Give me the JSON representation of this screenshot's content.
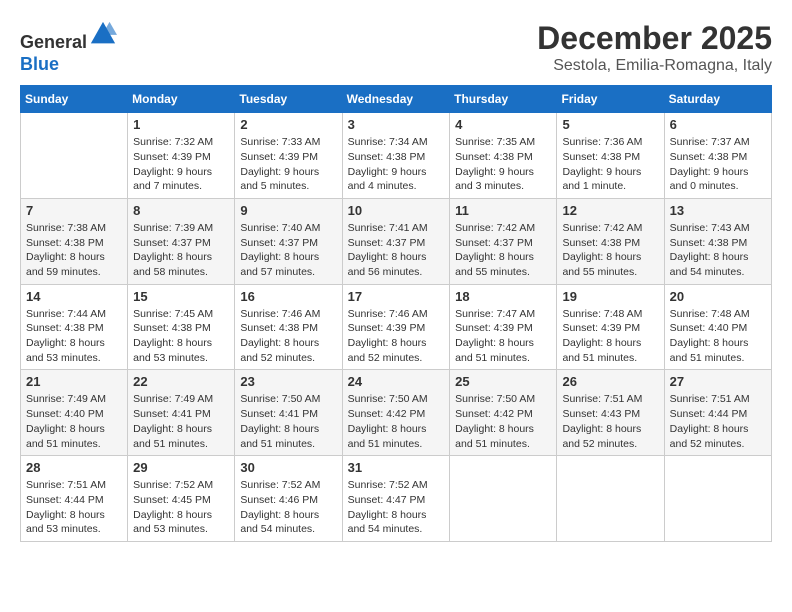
{
  "header": {
    "logo_general": "General",
    "logo_blue": "Blue",
    "month_title": "December 2025",
    "location": "Sestola, Emilia-Romagna, Italy"
  },
  "days_of_week": [
    "Sunday",
    "Monday",
    "Tuesday",
    "Wednesday",
    "Thursday",
    "Friday",
    "Saturday"
  ],
  "weeks": [
    [
      {
        "day": "",
        "sunrise": "",
        "sunset": "",
        "daylight": ""
      },
      {
        "day": "1",
        "sunrise": "Sunrise: 7:32 AM",
        "sunset": "Sunset: 4:39 PM",
        "daylight": "Daylight: 9 hours and 7 minutes."
      },
      {
        "day": "2",
        "sunrise": "Sunrise: 7:33 AM",
        "sunset": "Sunset: 4:39 PM",
        "daylight": "Daylight: 9 hours and 5 minutes."
      },
      {
        "day": "3",
        "sunrise": "Sunrise: 7:34 AM",
        "sunset": "Sunset: 4:38 PM",
        "daylight": "Daylight: 9 hours and 4 minutes."
      },
      {
        "day": "4",
        "sunrise": "Sunrise: 7:35 AM",
        "sunset": "Sunset: 4:38 PM",
        "daylight": "Daylight: 9 hours and 3 minutes."
      },
      {
        "day": "5",
        "sunrise": "Sunrise: 7:36 AM",
        "sunset": "Sunset: 4:38 PM",
        "daylight": "Daylight: 9 hours and 1 minute."
      },
      {
        "day": "6",
        "sunrise": "Sunrise: 7:37 AM",
        "sunset": "Sunset: 4:38 PM",
        "daylight": "Daylight: 9 hours and 0 minutes."
      }
    ],
    [
      {
        "day": "7",
        "sunrise": "Sunrise: 7:38 AM",
        "sunset": "Sunset: 4:38 PM",
        "daylight": "Daylight: 8 hours and 59 minutes."
      },
      {
        "day": "8",
        "sunrise": "Sunrise: 7:39 AM",
        "sunset": "Sunset: 4:37 PM",
        "daylight": "Daylight: 8 hours and 58 minutes."
      },
      {
        "day": "9",
        "sunrise": "Sunrise: 7:40 AM",
        "sunset": "Sunset: 4:37 PM",
        "daylight": "Daylight: 8 hours and 57 minutes."
      },
      {
        "day": "10",
        "sunrise": "Sunrise: 7:41 AM",
        "sunset": "Sunset: 4:37 PM",
        "daylight": "Daylight: 8 hours and 56 minutes."
      },
      {
        "day": "11",
        "sunrise": "Sunrise: 7:42 AM",
        "sunset": "Sunset: 4:37 PM",
        "daylight": "Daylight: 8 hours and 55 minutes."
      },
      {
        "day": "12",
        "sunrise": "Sunrise: 7:42 AM",
        "sunset": "Sunset: 4:38 PM",
        "daylight": "Daylight: 8 hours and 55 minutes."
      },
      {
        "day": "13",
        "sunrise": "Sunrise: 7:43 AM",
        "sunset": "Sunset: 4:38 PM",
        "daylight": "Daylight: 8 hours and 54 minutes."
      }
    ],
    [
      {
        "day": "14",
        "sunrise": "Sunrise: 7:44 AM",
        "sunset": "Sunset: 4:38 PM",
        "daylight": "Daylight: 8 hours and 53 minutes."
      },
      {
        "day": "15",
        "sunrise": "Sunrise: 7:45 AM",
        "sunset": "Sunset: 4:38 PM",
        "daylight": "Daylight: 8 hours and 53 minutes."
      },
      {
        "day": "16",
        "sunrise": "Sunrise: 7:46 AM",
        "sunset": "Sunset: 4:38 PM",
        "daylight": "Daylight: 8 hours and 52 minutes."
      },
      {
        "day": "17",
        "sunrise": "Sunrise: 7:46 AM",
        "sunset": "Sunset: 4:39 PM",
        "daylight": "Daylight: 8 hours and 52 minutes."
      },
      {
        "day": "18",
        "sunrise": "Sunrise: 7:47 AM",
        "sunset": "Sunset: 4:39 PM",
        "daylight": "Daylight: 8 hours and 51 minutes."
      },
      {
        "day": "19",
        "sunrise": "Sunrise: 7:48 AM",
        "sunset": "Sunset: 4:39 PM",
        "daylight": "Daylight: 8 hours and 51 minutes."
      },
      {
        "day": "20",
        "sunrise": "Sunrise: 7:48 AM",
        "sunset": "Sunset: 4:40 PM",
        "daylight": "Daylight: 8 hours and 51 minutes."
      }
    ],
    [
      {
        "day": "21",
        "sunrise": "Sunrise: 7:49 AM",
        "sunset": "Sunset: 4:40 PM",
        "daylight": "Daylight: 8 hours and 51 minutes."
      },
      {
        "day": "22",
        "sunrise": "Sunrise: 7:49 AM",
        "sunset": "Sunset: 4:41 PM",
        "daylight": "Daylight: 8 hours and 51 minutes."
      },
      {
        "day": "23",
        "sunrise": "Sunrise: 7:50 AM",
        "sunset": "Sunset: 4:41 PM",
        "daylight": "Daylight: 8 hours and 51 minutes."
      },
      {
        "day": "24",
        "sunrise": "Sunrise: 7:50 AM",
        "sunset": "Sunset: 4:42 PM",
        "daylight": "Daylight: 8 hours and 51 minutes."
      },
      {
        "day": "25",
        "sunrise": "Sunrise: 7:50 AM",
        "sunset": "Sunset: 4:42 PM",
        "daylight": "Daylight: 8 hours and 51 minutes."
      },
      {
        "day": "26",
        "sunrise": "Sunrise: 7:51 AM",
        "sunset": "Sunset: 4:43 PM",
        "daylight": "Daylight: 8 hours and 52 minutes."
      },
      {
        "day": "27",
        "sunrise": "Sunrise: 7:51 AM",
        "sunset": "Sunset: 4:44 PM",
        "daylight": "Daylight: 8 hours and 52 minutes."
      }
    ],
    [
      {
        "day": "28",
        "sunrise": "Sunrise: 7:51 AM",
        "sunset": "Sunset: 4:44 PM",
        "daylight": "Daylight: 8 hours and 53 minutes."
      },
      {
        "day": "29",
        "sunrise": "Sunrise: 7:52 AM",
        "sunset": "Sunset: 4:45 PM",
        "daylight": "Daylight: 8 hours and 53 minutes."
      },
      {
        "day": "30",
        "sunrise": "Sunrise: 7:52 AM",
        "sunset": "Sunset: 4:46 PM",
        "daylight": "Daylight: 8 hours and 54 minutes."
      },
      {
        "day": "31",
        "sunrise": "Sunrise: 7:52 AM",
        "sunset": "Sunset: 4:47 PM",
        "daylight": "Daylight: 8 hours and 54 minutes."
      },
      {
        "day": "",
        "sunrise": "",
        "sunset": "",
        "daylight": ""
      },
      {
        "day": "",
        "sunrise": "",
        "sunset": "",
        "daylight": ""
      },
      {
        "day": "",
        "sunrise": "",
        "sunset": "",
        "daylight": ""
      }
    ]
  ]
}
